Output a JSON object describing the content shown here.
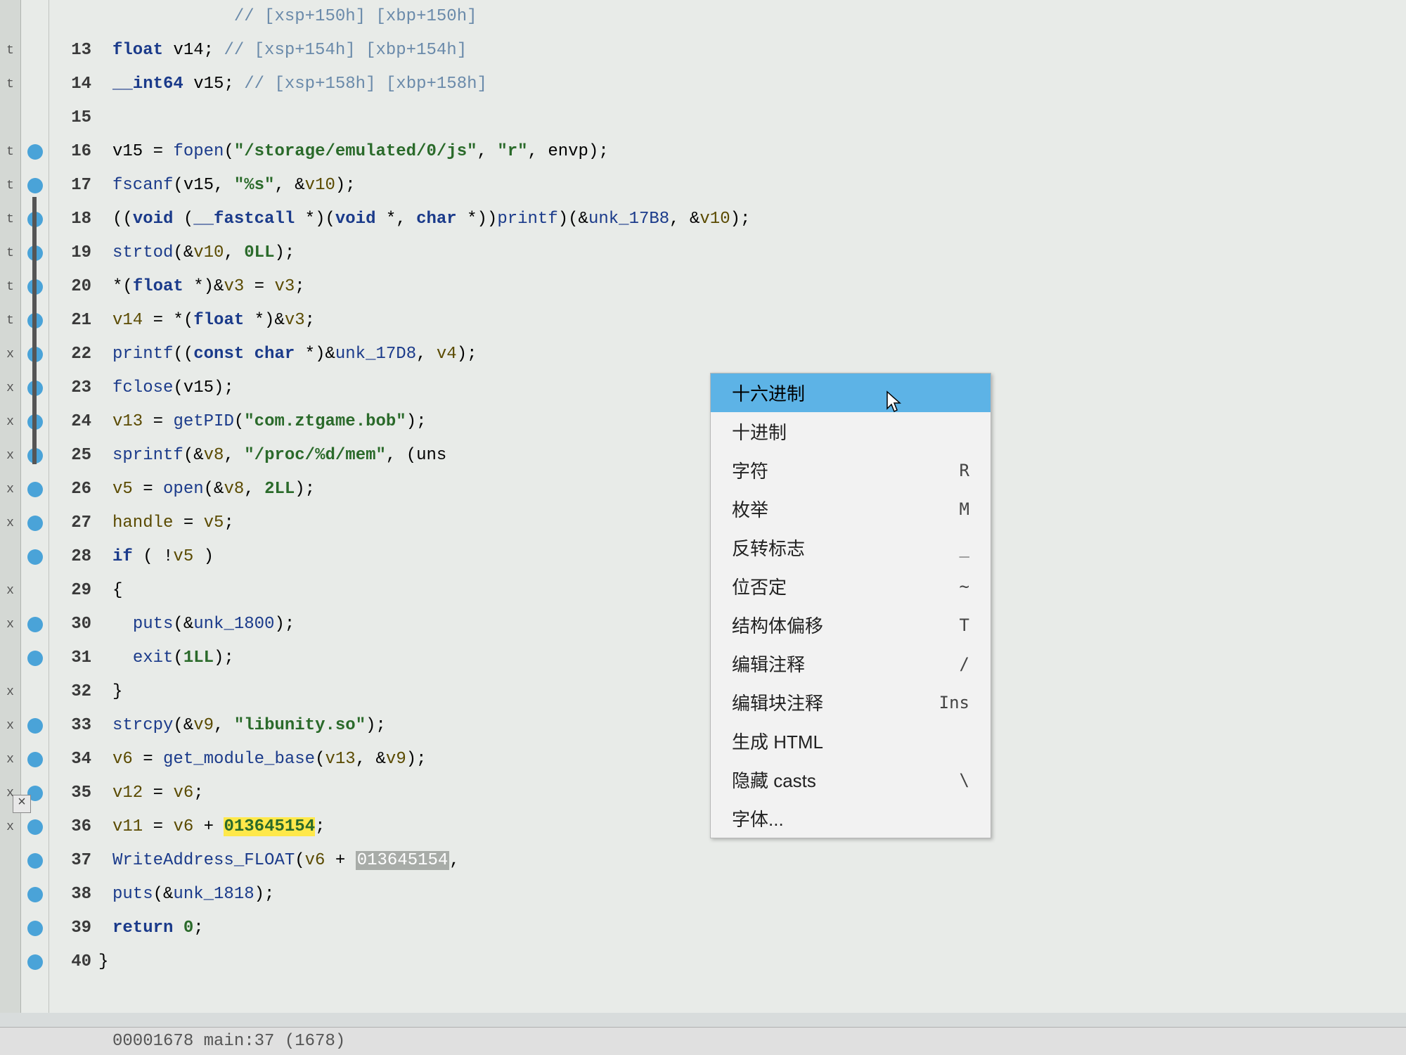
{
  "gutter_marks": [
    "",
    "t",
    "t",
    "",
    "t",
    "t",
    "t",
    "t",
    "t",
    "t",
    "x",
    "x",
    "x",
    "x",
    "x",
    "x",
    "",
    "x",
    "x",
    "",
    "x",
    "x",
    "x",
    "x",
    "x",
    "",
    "",
    "",
    "",
    ""
  ],
  "breakpoints": [
    false,
    false,
    false,
    true,
    true,
    true,
    true,
    true,
    true,
    true,
    true,
    true,
    true,
    true,
    true,
    true,
    true,
    false,
    true,
    true,
    false,
    true,
    true,
    true,
    true,
    true,
    true,
    true,
    true,
    true
  ],
  "line_nums": [
    "13",
    "14",
    "15",
    "16",
    "17",
    "18",
    "19",
    "20",
    "21",
    "22",
    "23",
    "24",
    "25",
    "26",
    "27",
    "28",
    "29",
    "30",
    "31",
    "32",
    "33",
    "34",
    "35",
    "36",
    "37",
    "38",
    "39",
    "40"
  ],
  "code": {
    "l12_pre": "            // ",
    "l12_cmt": "[xsp+150h] [xbp+150h]",
    "l13_a": "float",
    "l13_b": " v14; ",
    "l13_c": "// [xsp+154h] [xbp+154h]",
    "l14_a": "__int64",
    "l14_b": " v15; ",
    "l14_c": "// [xsp+158h] [xbp+158h]",
    "l16_a": "v15 = ",
    "l16_b": "fopen",
    "l16_c": "(",
    "l16_d": "\"/storage/emulated/0/js\"",
    "l16_e": ", ",
    "l16_f": "\"r\"",
    "l16_g": ", envp);",
    "l17_a": "fscanf",
    "l17_b": "(v15, ",
    "l17_c": "\"%s\"",
    "l17_d": ", &",
    "l17_e": "v10",
    "l17_f": ");",
    "l18_a": "((",
    "l18_b": "void",
    "l18_c": " (",
    "l18_d": "__fastcall",
    "l18_e": " *)(",
    "l18_f": "void",
    "l18_g": " *, ",
    "l18_h": "char",
    "l18_i": " *))",
    "l18_j": "printf",
    "l18_k": ")(&",
    "l18_l": "unk_17B8",
    "l18_m": ", &",
    "l18_n": "v10",
    "l18_o": ");",
    "l19_a": "strtod",
    "l19_b": "(&",
    "l19_c": "v10",
    "l19_d": ", ",
    "l19_e": "0LL",
    "l19_f": ");",
    "l20_a": "*(",
    "l20_b": "float",
    "l20_c": " *)&",
    "l20_d": "v3",
    "l20_e": " = ",
    "l20_f": "v3",
    "l20_g": ";",
    "l21_a": "v14",
    "l21_b": " = *(",
    "l21_c": "float",
    "l21_d": " *)&",
    "l21_e": "v3",
    "l21_f": ";",
    "l22_a": "printf",
    "l22_b": "((",
    "l22_c": "const char",
    "l22_d": " *)&",
    "l22_e": "unk_17D8",
    "l22_f": ", ",
    "l22_g": "v4",
    "l22_h": ");",
    "l23_a": "fclose",
    "l23_b": "(v15);",
    "l24_a": "v13",
    "l24_b": " = ",
    "l24_c": "getPID",
    "l24_d": "(",
    "l24_e": "\"com.ztgame.bob\"",
    "l24_f": ");",
    "l25_a": "sprintf",
    "l25_b": "(&",
    "l25_c": "v8",
    "l25_d": ", ",
    "l25_e": "\"/proc/%d/mem\"",
    "l25_f": ", (uns",
    "l26_a": "v5",
    "l26_b": " = ",
    "l26_c": "open",
    "l26_d": "(&",
    "l26_e": "v8",
    "l26_f": ", ",
    "l26_g": "2LL",
    "l26_h": ");",
    "l27_a": "handle",
    "l27_b": " = ",
    "l27_c": "v5",
    "l27_d": ";",
    "l28_a": "if",
    "l28_b": " ( !",
    "l28_c": "v5",
    "l28_d": " )",
    "l29": "{",
    "l30_a": "  ",
    "l30_b": "puts",
    "l30_c": "(&",
    "l30_d": "unk_1800",
    "l30_e": ");",
    "l31_a": "  ",
    "l31_b": "exit",
    "l31_c": "(",
    "l31_d": "1LL",
    "l31_e": ");",
    "l32": "}",
    "l33_a": "strcpy",
    "l33_b": "(&",
    "l33_c": "v9",
    "l33_d": ", ",
    "l33_e": "\"libunity.so\"",
    "l33_f": ");",
    "l34_a": "v6",
    "l34_b": " = ",
    "l34_c": "get_module_base",
    "l34_d": "(",
    "l34_e": "v13",
    "l34_f": ", &",
    "l34_g": "v9",
    "l34_h": ");",
    "l35_a": "v12",
    "l35_b": " = ",
    "l35_c": "v6",
    "l35_d": ";",
    "l36_a": "v11",
    "l36_b": " = ",
    "l36_c": "v6",
    "l36_d": " + ",
    "l36_e": "013645154",
    "l36_f": ";",
    "l37_a": "WriteAddress_FLOAT",
    "l37_b": "(",
    "l37_c": "v6",
    "l37_d": " + ",
    "l37_e": "013645154",
    "l37_f": ",",
    "l38_a": "puts",
    "l38_b": "(&",
    "l38_c": "unk_1818",
    "l38_d": ");",
    "l39_a": "return",
    "l39_b": " ",
    "l39_c": "0",
    "l39_d": ";",
    "l40": "}"
  },
  "menu": [
    {
      "label": "十六进制",
      "shortcut": ""
    },
    {
      "label": "十进制",
      "shortcut": ""
    },
    {
      "label": "字符",
      "shortcut": "R"
    },
    {
      "label": "枚举",
      "shortcut": "M"
    },
    {
      "label": "反转标志",
      "shortcut": "_"
    },
    {
      "label": "位否定",
      "shortcut": "~"
    },
    {
      "label": "结构体偏移",
      "shortcut": "T"
    },
    {
      "label": "编辑注释",
      "shortcut": "/"
    },
    {
      "label": "编辑块注释",
      "shortcut": "Ins"
    },
    {
      "label": "生成 HTML",
      "shortcut": ""
    },
    {
      "label": "隐藏 casts",
      "shortcut": "\\"
    },
    {
      "label": "字体...",
      "shortcut": ""
    }
  ],
  "status": "00001678 main:37 (1678)",
  "close": "×"
}
